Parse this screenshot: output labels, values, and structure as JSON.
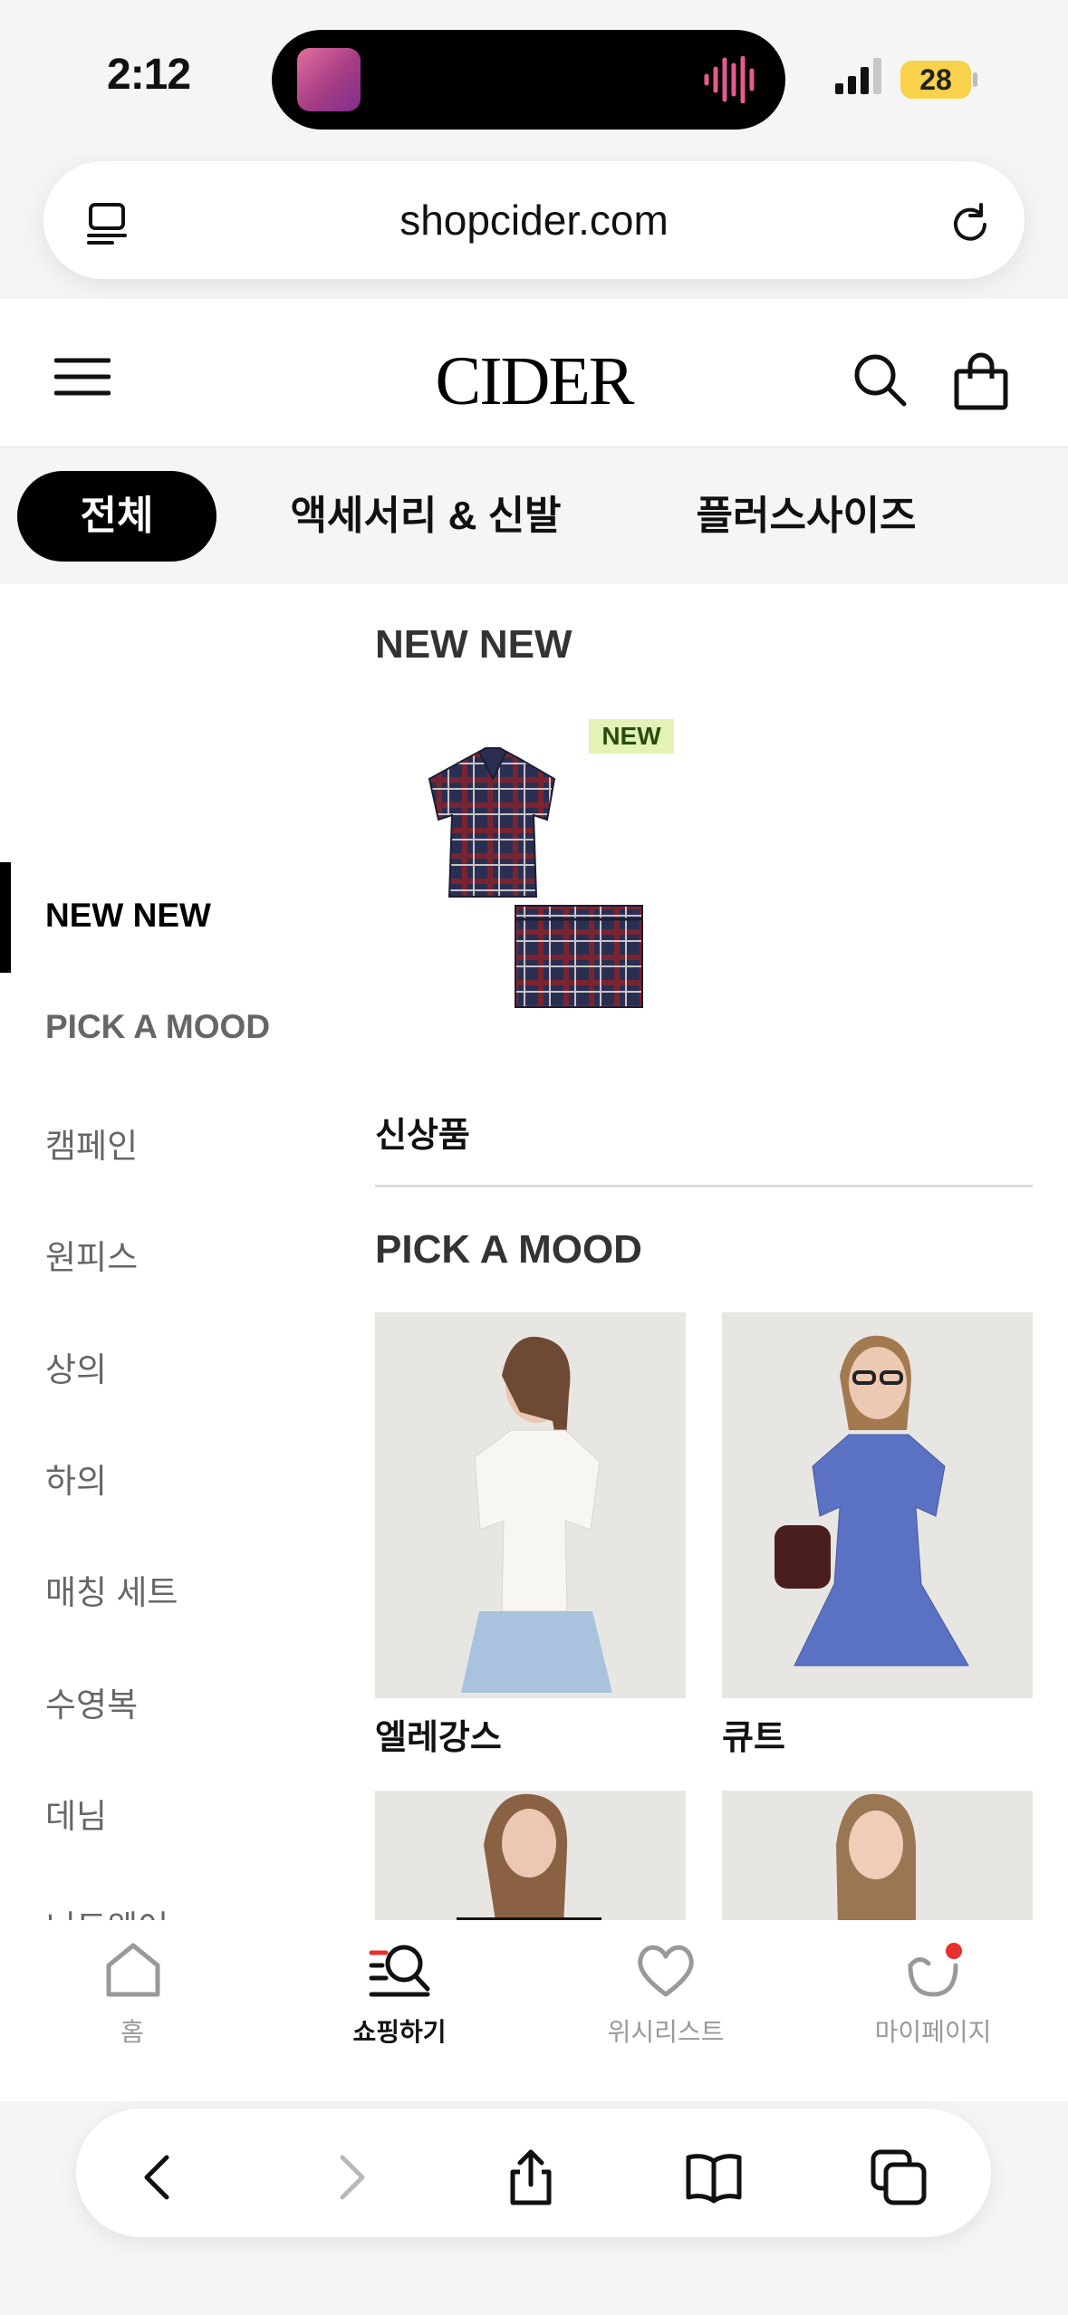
{
  "status_bar": {
    "time": "2:12",
    "battery": "28"
  },
  "browser": {
    "url": "shopcider.com"
  },
  "header": {
    "logo": "CIDER"
  },
  "category_tabs": [
    {
      "label": "전체",
      "active": true
    },
    {
      "label": "액세서리 & 신발",
      "active": false
    },
    {
      "label": "플러스사이즈",
      "active": false
    }
  ],
  "sidebar": {
    "active_index": 0,
    "items": [
      {
        "label": "NEW NEW"
      },
      {
        "label": "PICK A MOOD"
      },
      {
        "label": "캠페인"
      },
      {
        "label": "원피스"
      },
      {
        "label": "상의"
      },
      {
        "label": "하의"
      },
      {
        "label": "매칭 세트"
      },
      {
        "label": "수영복"
      },
      {
        "label": "데님"
      },
      {
        "label": "니트웨어"
      }
    ]
  },
  "sections": {
    "new_new": {
      "title": "NEW NEW",
      "badge": "NEW",
      "item_label": "신상품"
    },
    "pick_a_mood": {
      "title": "PICK A MOOD",
      "cards": [
        {
          "label": "엘레강스"
        },
        {
          "label": "큐트"
        },
        {
          "label": ""
        },
        {
          "label": ""
        }
      ]
    }
  },
  "bottom_nav": [
    {
      "label": "홈",
      "icon": "home-icon",
      "active": false
    },
    {
      "label": "쇼핑하기",
      "icon": "shop-search-icon",
      "active": true
    },
    {
      "label": "위시리스트",
      "icon": "heart-icon",
      "active": false
    },
    {
      "label": "마이페이지",
      "icon": "profile-icon",
      "active": false
    }
  ],
  "colors": {
    "accent": "#000000",
    "badge_bg": "#e3f3b5",
    "notify": "#e8302e"
  }
}
